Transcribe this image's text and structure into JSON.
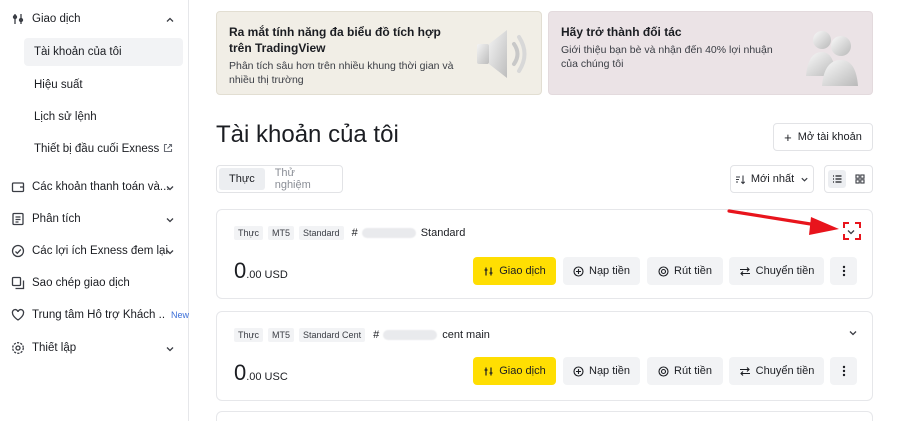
{
  "sidebar": {
    "trading": {
      "label": "Giao dịch",
      "icon": "trading-icon",
      "expanded": true
    },
    "sub_items": [
      {
        "label": "Tài khoản của tôi",
        "active": true
      },
      {
        "label": "Hiệu suất"
      },
      {
        "label": "Lịch sử lệnh"
      },
      {
        "label": "Thiết bị đầu cuối Exness",
        "external": true
      }
    ],
    "groups": [
      {
        "label": "Các khoản thanh toán và...",
        "icon": "wallet-icon"
      },
      {
        "label": "Phân tích",
        "icon": "analytics-icon"
      },
      {
        "label": "Các lợi ích Exness đem lại",
        "icon": "benefits-icon"
      },
      {
        "label": "Sao chép giao dịch",
        "icon": "copy-trading-icon"
      },
      {
        "label": "Trung tâm Hỗ trợ Khách ...",
        "icon": "heart-icon",
        "badge": "New"
      },
      {
        "label": "Thiết lập",
        "icon": "settings-icon"
      }
    ]
  },
  "banners": [
    {
      "title": "Ra mắt tính năng đa biểu đồ tích hợp trên TradingView",
      "subtitle": "Phân tích sâu hơn trên nhiều khung thời gian và nhiều thị trường",
      "bg": "#f1eee6",
      "art": "speaker-icon"
    },
    {
      "title": "Hãy trở thành đối tác",
      "subtitle": "Giới thiệu bạn bè và nhận đến 40% lợi nhuận của chúng tôi",
      "bg": "#ebe3e6",
      "art": "partners-icon"
    }
  ],
  "main": {
    "title": "Tài khoản của tôi",
    "open_account": "Mở tài khoản",
    "tabs": [
      {
        "label": "Thực",
        "active": true
      },
      {
        "label": "Thử nghiệm"
      }
    ],
    "sort": "Mới nhất"
  },
  "accounts": [
    {
      "tags": [
        "Thực",
        "MT5",
        "Standard"
      ],
      "number_prefix": "#",
      "name": "Standard",
      "balance_int": "0",
      "balance_dec": ".00",
      "currency": "USD"
    },
    {
      "tags": [
        "Thực",
        "MT5",
        "Standard Cent"
      ],
      "number_prefix": "#",
      "name": "cent main",
      "balance_int": "0",
      "balance_dec": ".00",
      "currency": "USC"
    }
  ],
  "actions": {
    "trade": "Giao dịch",
    "deposit": "Nạp tiền",
    "withdraw": "Rút tiền",
    "transfer": "Chuyển tiền"
  },
  "colors": {
    "accent": "#ffde02",
    "annotation": "#e8141c",
    "new_badge": "#3b6fd8"
  }
}
